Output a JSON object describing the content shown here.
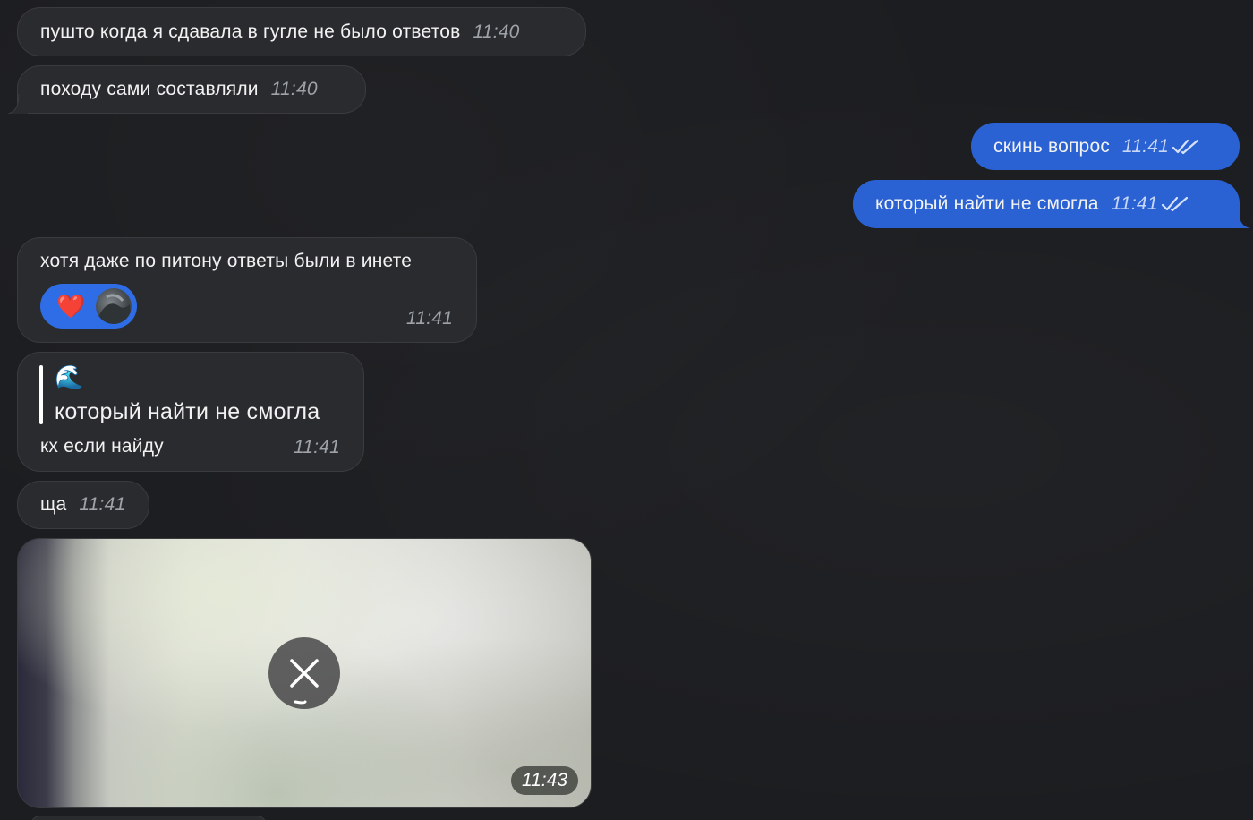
{
  "messages": {
    "m1": {
      "text": "пушто когда я сдавала в гугле не было ответов",
      "time": "11:40"
    },
    "m2": {
      "text": "походу сами составляли",
      "time": "11:40"
    },
    "m3": {
      "text": "скинь вопрос",
      "time": "11:41"
    },
    "m4": {
      "text": "который найти не смогла",
      "time": "11:41"
    },
    "m5": {
      "text": "хотя даже по питону ответы были в инете",
      "time": "11:41",
      "reaction": "❤️"
    },
    "m6": {
      "quote_emoji": "🌊",
      "quote_text": "который найти не смогла",
      "text": "кх если найду",
      "time": "11:41"
    },
    "m7": {
      "text": "ща",
      "time": "11:41"
    },
    "m8": {
      "time": "11:43"
    }
  },
  "colors": {
    "background": "#1c1d20",
    "incoming_bubble": "#2a2b2e",
    "outgoing_bubble": "#2a62d3",
    "reaction_pill": "#2f6de6"
  },
  "icons": {
    "read_ticks": "double-check-icon",
    "media_cancel": "close-icon"
  }
}
